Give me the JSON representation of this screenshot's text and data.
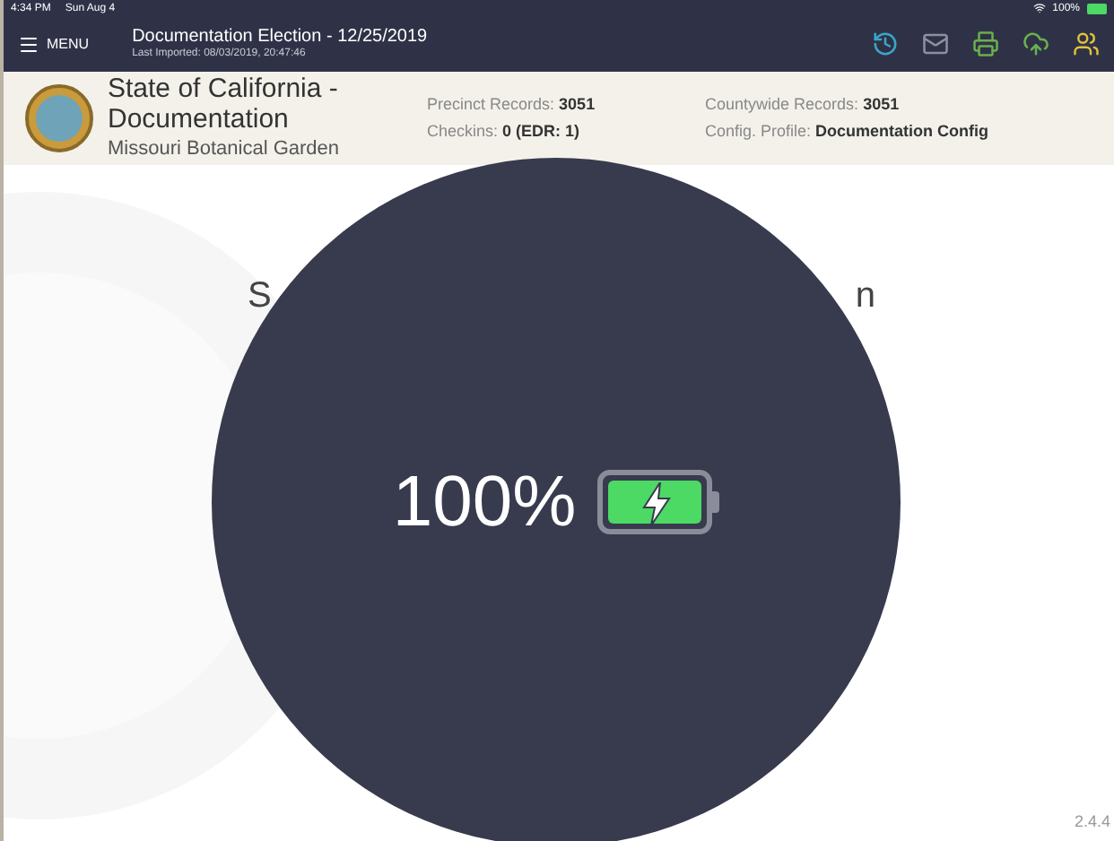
{
  "status_bar": {
    "time": "4:34 PM",
    "date": "Sun Aug 4",
    "battery_text": "100%"
  },
  "top_bar": {
    "menu_label": "MENU",
    "election_title": "Documentation Election - 12/25/2019",
    "last_imported": "Last Imported: 08/03/2019, 20:47:46"
  },
  "header": {
    "title": "State of California - Documentation",
    "subtitle": "Missouri Botanical Garden",
    "stats": [
      {
        "label": "Precinct Records:",
        "value": "3051"
      },
      {
        "label": "Checkins:",
        "value": "0 (EDR: 1)"
      },
      {
        "label": "Countywide Records:",
        "value": "3051"
      },
      {
        "label": "Config. Profile:",
        "value": "Documentation Config"
      }
    ]
  },
  "heading_fragments": [
    "S",
    "n"
  ],
  "battery_overlay": {
    "text": "100%",
    "level": 1,
    "charging": true
  },
  "version": "2.4.4"
}
